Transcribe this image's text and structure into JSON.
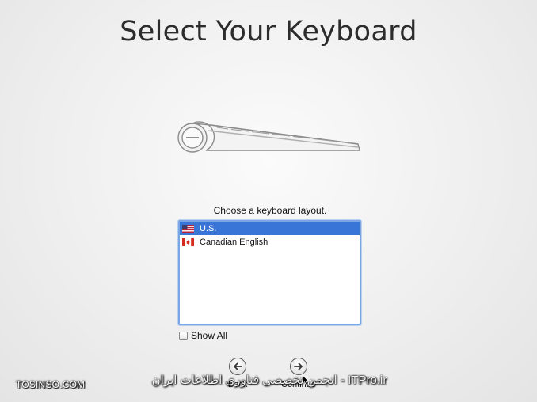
{
  "title": "Select Your Keyboard",
  "prompt": "Choose a keyboard layout.",
  "layouts": [
    {
      "label": "U.S.",
      "flag": "us-flag",
      "selected": true
    },
    {
      "label": "Canadian English",
      "flag": "canada-flag",
      "selected": false
    }
  ],
  "show_all": {
    "label": "Show All",
    "checked": false
  },
  "buttons": {
    "back": {
      "label": "Back",
      "icon": "left-arrow-icon"
    },
    "continue": {
      "label": "Continue",
      "icon": "right-arrow-icon"
    }
  },
  "watermark": {
    "left": "TOSINSO.COM",
    "center": "انجمن تخصصی فناوری اطلاعات ایران - ITPro.ir"
  },
  "colors": {
    "selection": "#3875d7",
    "list_border": "#7aa6e6"
  }
}
